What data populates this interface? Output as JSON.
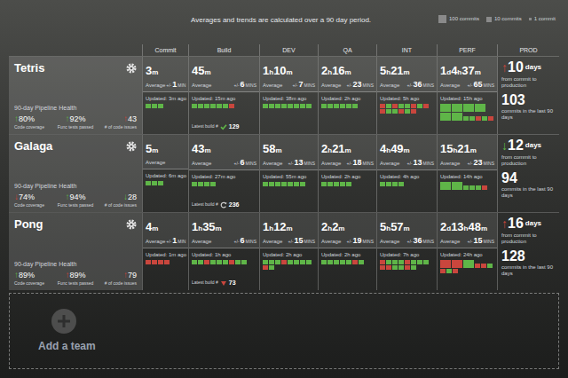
{
  "header": {
    "title": "Averages and trends are calculated over a 90 day period.",
    "legend": [
      {
        "kind": "hundred",
        "label": "100 commits"
      },
      {
        "kind": "ten",
        "label": "10 commits"
      },
      {
        "kind": "one",
        "label": "1 commit"
      }
    ]
  },
  "columns": [
    "Commit",
    "Build",
    "DEV",
    "QA",
    "INT",
    "PERF",
    "PROD"
  ],
  "teams": [
    {
      "name": "Tetris",
      "health_title": "90-day Pipeline Health",
      "metrics": [
        {
          "arrow": "↑",
          "value": "80%",
          "label": "Code coverage",
          "color": "#5fb548"
        },
        {
          "arrow": "↑",
          "value": "92%",
          "label": "Func tests passed",
          "color": "#5fb548"
        },
        {
          "arrow": "↑",
          "value": "43",
          "label": "# of code issues",
          "color": "#c9463d"
        }
      ],
      "stages": [
        {
          "time": "3m",
          "avg_label": "Average",
          "pm": "+/-",
          "dev": "1",
          "unit": "MIN",
          "updated": "Updated: 3m ago",
          "blocks": [
            {
              "kind": "ten",
              "color": "#5fb548"
            },
            {
              "kind": "ten",
              "color": "#5fb548"
            },
            {
              "kind": "ten",
              "color": "#5fb548"
            }
          ]
        },
        {
          "time": "45m",
          "avg_label": "Average",
          "pm": "+/-",
          "dev": "6",
          "unit": "MINS",
          "updated": "Updated: 15m ago",
          "blocks": [
            {
              "kind": "ten",
              "color": "#5fb548"
            },
            {
              "kind": "ten",
              "color": "#5fb548"
            },
            {
              "kind": "ten",
              "color": "#5fb548"
            },
            {
              "kind": "ten",
              "color": "#5fb548"
            },
            {
              "kind": "ten",
              "color": "#5fb548"
            },
            {
              "kind": "ten",
              "color": "#5fb548"
            },
            {
              "kind": "ten",
              "color": "#c9463d"
            }
          ],
          "latest_build": {
            "label": "Latest build #",
            "number": "129",
            "status": "passed"
          }
        },
        {
          "time": "1h10m",
          "avg_label": "Average",
          "pm": "+/-",
          "dev": "7",
          "unit": "MINS",
          "updated": "Updated: 38m ago",
          "blocks": [
            {
              "kind": "ten",
              "color": "#5fb548"
            },
            {
              "kind": "ten",
              "color": "#5fb548"
            },
            {
              "kind": "ten",
              "color": "#5fb548"
            },
            {
              "kind": "ten",
              "color": "#5fb548"
            },
            {
              "kind": "ten",
              "color": "#5fb548"
            },
            {
              "kind": "ten",
              "color": "#5fb548"
            },
            {
              "kind": "ten",
              "color": "#5fb548"
            },
            {
              "kind": "ten",
              "color": "#5fb548"
            }
          ]
        },
        {
          "time": "2h16m",
          "avg_label": "Average",
          "pm": "+/-",
          "dev": "23",
          "unit": "MINS",
          "updated": "Updated: 2h ago",
          "blocks": [
            {
              "kind": "ten",
              "color": "#5fb548"
            },
            {
              "kind": "ten",
              "color": "#5fb548"
            },
            {
              "kind": "ten",
              "color": "#5fb548"
            },
            {
              "kind": "ten",
              "color": "#5fb548"
            },
            {
              "kind": "ten",
              "color": "#5fb548"
            },
            {
              "kind": "ten",
              "color": "#5fb548"
            }
          ]
        },
        {
          "time": "5h21m",
          "avg_label": "Average",
          "pm": "+/-",
          "dev": "36",
          "unit": "MINS",
          "updated": "Updated: 5h ago",
          "blocks": [
            {
              "kind": "ten",
              "color": "#c9463d"
            },
            {
              "kind": "ten",
              "color": "#5fb548"
            },
            {
              "kind": "ten",
              "color": "#c9463d"
            },
            {
              "kind": "ten",
              "color": "#5fb548"
            },
            {
              "kind": "ten",
              "color": "#5fb548"
            },
            {
              "kind": "ten",
              "color": "#c9463d"
            },
            {
              "kind": "ten",
              "color": "#5fb548"
            },
            {
              "kind": "ten",
              "color": "#c9463d"
            },
            {
              "kind": "ten",
              "color": "#c9463d"
            },
            {
              "kind": "ten",
              "color": "#5fb548"
            },
            {
              "kind": "ten",
              "color": "#5fb548"
            },
            {
              "kind": "ten",
              "color": "#c9463d"
            },
            {
              "kind": "ten",
              "color": "#5fb548"
            },
            {
              "kind": "ten",
              "color": "#c9463d"
            }
          ]
        },
        {
          "time": "1d4h37m",
          "avg_label": "Average",
          "pm": "+/-",
          "dev": "65",
          "unit": "MINS",
          "updated": "Updated: 15h ago",
          "blocks": [
            {
              "kind": "hundred",
              "color": "#5fb548"
            },
            {
              "kind": "hundred",
              "color": "#5fb548"
            },
            {
              "kind": "hundred",
              "color": "#5fb548"
            },
            {
              "kind": "hundred",
              "color": "#5fb548"
            },
            {
              "kind": "hundred",
              "color": "#5fb548"
            },
            {
              "kind": "hundred",
              "color": "#5fb548"
            },
            {
              "kind": "ten",
              "color": "#5fb548"
            },
            {
              "kind": "ten",
              "color": "#5fb548"
            },
            {
              "kind": "ten",
              "color": "#c9463d"
            },
            {
              "kind": "ten",
              "color": "#5fb548"
            },
            {
              "kind": "ten",
              "color": "#c9463d"
            }
          ]
        }
      ],
      "prod": {
        "arrow": "↑",
        "arrow_color": "#c9463d",
        "value": "10",
        "unit": "days",
        "caption": "from commit to production",
        "commits": "103",
        "commits_caption": "commits in the last 90 days"
      }
    },
    {
      "name": "Galaga",
      "health_title": "90-day Pipeline Health",
      "metrics": [
        {
          "arrow": "↓",
          "value": "74%",
          "label": "Code coverage",
          "color": "#c9463d"
        },
        {
          "arrow": "↑",
          "value": "94%",
          "label": "Func tests passed",
          "color": "#5fb548"
        },
        {
          "arrow": "↓",
          "value": "28",
          "label": "# of code issues",
          "color": "#5fb548"
        }
      ],
      "stages": [
        {
          "time": "5m",
          "avg_label": "Average",
          "updated": "Updated: 6m ago",
          "blocks": [
            {
              "kind": "ten",
              "color": "#5fb548"
            },
            {
              "kind": "ten",
              "color": "#5fb548"
            },
            {
              "kind": "ten",
              "color": "#5fb548"
            }
          ]
        },
        {
          "time": "43m",
          "avg_label": "Average",
          "pm": "+/-",
          "dev": "6",
          "unit": "MINS",
          "updated": "Updated: 27m ago",
          "blocks": [
            {
              "kind": "ten",
              "color": "#5fb548"
            },
            {
              "kind": "ten",
              "color": "#5fb548"
            },
            {
              "kind": "ten",
              "color": "#5fb548"
            },
            {
              "kind": "ten",
              "color": "#5fb548"
            }
          ],
          "latest_build": {
            "label": "Latest build #",
            "number": "236",
            "status": "running"
          }
        },
        {
          "time": "58m",
          "avg_label": "Average",
          "pm": "+/-",
          "dev": "13",
          "unit": "MINS",
          "updated": "Updated: 55m ago",
          "blocks": [
            {
              "kind": "ten",
              "color": "#5fb548"
            },
            {
              "kind": "ten",
              "color": "#5fb548"
            },
            {
              "kind": "ten",
              "color": "#5fb548"
            },
            {
              "kind": "ten",
              "color": "#5fb548"
            },
            {
              "kind": "ten",
              "color": "#5fb548"
            },
            {
              "kind": "ten",
              "color": "#5fb548"
            },
            {
              "kind": "ten",
              "color": "#5fb548"
            }
          ]
        },
        {
          "time": "2h21m",
          "avg_label": "Average",
          "pm": "+/-",
          "dev": "18",
          "unit": "MINS",
          "updated": "Updated: 2h ago",
          "blocks": [
            {
              "kind": "ten",
              "color": "#5fb548"
            },
            {
              "kind": "ten",
              "color": "#5fb548"
            },
            {
              "kind": "ten",
              "color": "#5fb548"
            },
            {
              "kind": "ten",
              "color": "#5fb548"
            },
            {
              "kind": "ten",
              "color": "#5fb548"
            }
          ]
        },
        {
          "time": "4h49m",
          "avg_label": "Average",
          "pm": "+/-",
          "dev": "13",
          "unit": "MINS",
          "updated": "Updated: 4h ago",
          "blocks": [
            {
              "kind": "ten",
              "color": "#5fb548"
            },
            {
              "kind": "ten",
              "color": "#5fb548"
            },
            {
              "kind": "ten",
              "color": "#5fb548"
            },
            {
              "kind": "ten",
              "color": "#5fb548"
            }
          ]
        },
        {
          "time": "15h21m",
          "avg_label": "Average",
          "pm": "+/-",
          "dev": "23",
          "unit": "MINS",
          "updated": "Updated: 14h ago",
          "blocks": [
            {
              "kind": "hundred",
              "color": "#5fb548"
            },
            {
              "kind": "hundred",
              "color": "#5fb548"
            },
            {
              "kind": "ten",
              "color": "#5fb548"
            },
            {
              "kind": "ten",
              "color": "#5fb548"
            },
            {
              "kind": "ten",
              "color": "#5fb548"
            },
            {
              "kind": "ten",
              "color": "#c9463d"
            }
          ]
        }
      ],
      "prod": {
        "arrow": "↓",
        "arrow_color": "#5fb548",
        "value": "12",
        "unit": "days",
        "caption": "from commit to production",
        "commits": "94",
        "commits_caption": "commits in the last 90 days"
      }
    },
    {
      "name": "Pong",
      "health_title": "90-day Pipeline Health",
      "metrics": [
        {
          "arrow": "↑",
          "value": "89%",
          "label": "Code coverage",
          "color": "#5fb548"
        },
        {
          "arrow": "↑",
          "value": "89%",
          "label": "Func tests passed",
          "color": "#c9463d"
        },
        {
          "arrow": "↑",
          "value": "79",
          "label": "# of code issues",
          "color": "#c9463d"
        }
      ],
      "stages": [
        {
          "time": "4m",
          "avg_label": "Average",
          "pm": "+/-",
          "dev": "1",
          "unit": "MIN",
          "updated": "Updated: 1m ago",
          "blocks": [
            {
              "kind": "ten",
              "color": "#c9463d"
            },
            {
              "kind": "ten",
              "color": "#c9463d"
            },
            {
              "kind": "ten",
              "color": "#c9463d"
            },
            {
              "kind": "ten",
              "color": "#c9463d"
            }
          ]
        },
        {
          "time": "1h35m",
          "avg_label": "Average",
          "pm": "+/-",
          "dev": "6",
          "unit": "MINS",
          "updated": "Updated: 1h ago",
          "blocks": [
            {
              "kind": "ten",
              "color": "#5fb548"
            },
            {
              "kind": "ten",
              "color": "#5fb548"
            },
            {
              "kind": "ten",
              "color": "#c9463d"
            },
            {
              "kind": "ten",
              "color": "#5fb548"
            },
            {
              "kind": "ten",
              "color": "#5fb548"
            },
            {
              "kind": "ten",
              "color": "#5fb548"
            },
            {
              "kind": "ten",
              "color": "#c9463d"
            },
            {
              "kind": "ten",
              "color": "#5fb548"
            },
            {
              "kind": "ten",
              "color": "#5fb548"
            }
          ],
          "latest_build": {
            "label": "Latest build #",
            "number": "73",
            "status": "failed"
          }
        },
        {
          "time": "1h12m",
          "avg_label": "Average",
          "pm": "+/-",
          "dev": "15",
          "unit": "MINS",
          "updated": "Updated: 2h ago",
          "blocks": [
            {
              "kind": "ten",
              "color": "#5fb548"
            },
            {
              "kind": "ten",
              "color": "#5fb548"
            },
            {
              "kind": "ten",
              "color": "#5fb548"
            },
            {
              "kind": "ten",
              "color": "#c9463d"
            },
            {
              "kind": "ten",
              "color": "#5fb548"
            },
            {
              "kind": "ten",
              "color": "#5fb548"
            },
            {
              "kind": "ten",
              "color": "#5fb548"
            },
            {
              "kind": "ten",
              "color": "#5fb548"
            },
            {
              "kind": "ten",
              "color": "#c9463d"
            },
            {
              "kind": "ten",
              "color": "#5fb548"
            }
          ]
        },
        {
          "time": "2h2m",
          "avg_label": "Average",
          "pm": "+/-",
          "dev": "19",
          "unit": "MINS",
          "updated": "Updated: 2h ago",
          "blocks": [
            {
              "kind": "ten",
              "color": "#5fb548"
            },
            {
              "kind": "ten",
              "color": "#5fb548"
            },
            {
              "kind": "ten",
              "color": "#5fb548"
            },
            {
              "kind": "ten",
              "color": "#5fb548"
            },
            {
              "kind": "ten",
              "color": "#5fb548"
            },
            {
              "kind": "ten",
              "color": "#c9463d"
            },
            {
              "kind": "ten",
              "color": "#5fb548"
            }
          ]
        },
        {
          "time": "5h57m",
          "avg_label": "Average",
          "pm": "+/-",
          "dev": "36",
          "unit": "MINS",
          "updated": "Updated: 7h ago",
          "blocks": [
            {
              "kind": "ten",
              "color": "#c9463d"
            },
            {
              "kind": "ten",
              "color": "#5fb548"
            },
            {
              "kind": "ten",
              "color": "#5fb548"
            },
            {
              "kind": "ten",
              "color": "#5fb548"
            },
            {
              "kind": "ten",
              "color": "#c9463d"
            },
            {
              "kind": "ten",
              "color": "#5fb548"
            },
            {
              "kind": "ten",
              "color": "#5fb548"
            },
            {
              "kind": "ten",
              "color": "#5fb548"
            },
            {
              "kind": "ten",
              "color": "#c9463d"
            },
            {
              "kind": "ten",
              "color": "#c9463d"
            },
            {
              "kind": "ten",
              "color": "#5fb548"
            },
            {
              "kind": "ten",
              "color": "#5fb548"
            },
            {
              "kind": "ten",
              "color": "#c9463d"
            },
            {
              "kind": "ten",
              "color": "#5fb548"
            }
          ]
        },
        {
          "time": "2d13h48m",
          "avg_label": "Average",
          "pm": "+/-",
          "dev": "15",
          "unit": "MINS",
          "updated": "Updated: 24h ago",
          "blocks": [
            {
              "kind": "hundred",
              "color": "#c9463d"
            },
            {
              "kind": "hundred",
              "color": "#c9463d"
            },
            {
              "kind": "hundred",
              "color": "#5fb548"
            },
            {
              "kind": "ten",
              "color": "#c9463d"
            },
            {
              "kind": "ten",
              "color": "#c9463d"
            },
            {
              "kind": "ten",
              "color": "#5fb548"
            },
            {
              "kind": "ten",
              "color": "#c9463d"
            },
            {
              "kind": "ten",
              "color": "#5fb548"
            },
            {
              "kind": "ten",
              "color": "#c9463d"
            }
          ]
        }
      ],
      "prod": {
        "arrow": "↑",
        "arrow_color": "#c9463d",
        "value": "16",
        "unit": "days",
        "caption": "from commit to production",
        "commits": "128",
        "commits_caption": "commits in the last 90 days"
      }
    }
  ],
  "add_team": {
    "label": "Add a team"
  }
}
